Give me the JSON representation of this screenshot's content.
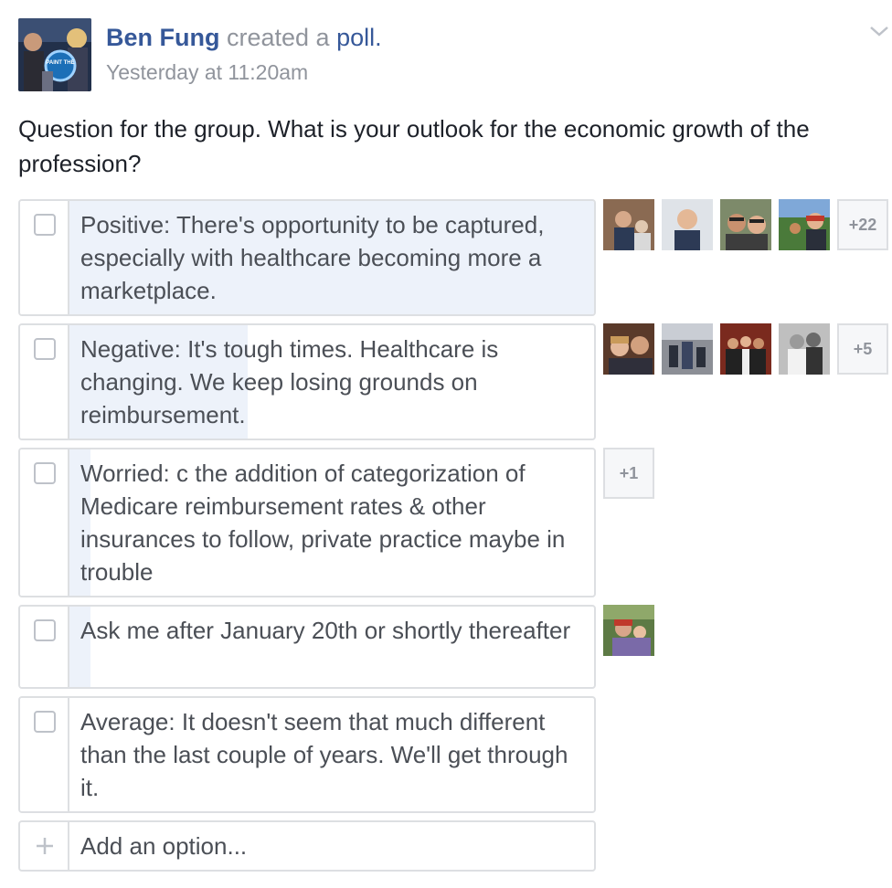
{
  "post": {
    "author": "Ben Fung",
    "action_text": "created a",
    "action_link": "poll.",
    "timestamp": "Yesterday at 11:20am",
    "avatar_text": "PAINT THE"
  },
  "question": "Question for the group. What is your outlook for the economic growth of the profession?",
  "options": [
    {
      "text": "Positive: There's opportunity to be captured, especially with healthcare becoming more a marketplace.",
      "more_voters": "+22",
      "vote_fraction": 1.0
    },
    {
      "text": "Negative: It's tough times. Healthcare is changing. We keep losing grounds on reimbursement.",
      "more_voters": "+5",
      "vote_fraction": 0.34
    },
    {
      "text": "Worried: c the addition of categorization of Medicare reimbursement rates & other insurances to follow, private practice maybe in trouble",
      "more_voters": "+1",
      "vote_fraction": 0.04
    },
    {
      "text": "Ask me after January 20th or shortly thereafter",
      "more_voters": "",
      "vote_fraction": 0.04
    },
    {
      "text": "Average: It doesn't seem that much different than the last couple of years. We'll get through it.",
      "more_voters": "",
      "vote_fraction": 0.0
    }
  ],
  "add_option": {
    "placeholder": "Add an option..."
  },
  "colors": {
    "link": "#365899",
    "meta": "#90949c",
    "border": "#dddfe2",
    "vote_fill": "#edf2fa",
    "option_text": "#4b4f56"
  }
}
